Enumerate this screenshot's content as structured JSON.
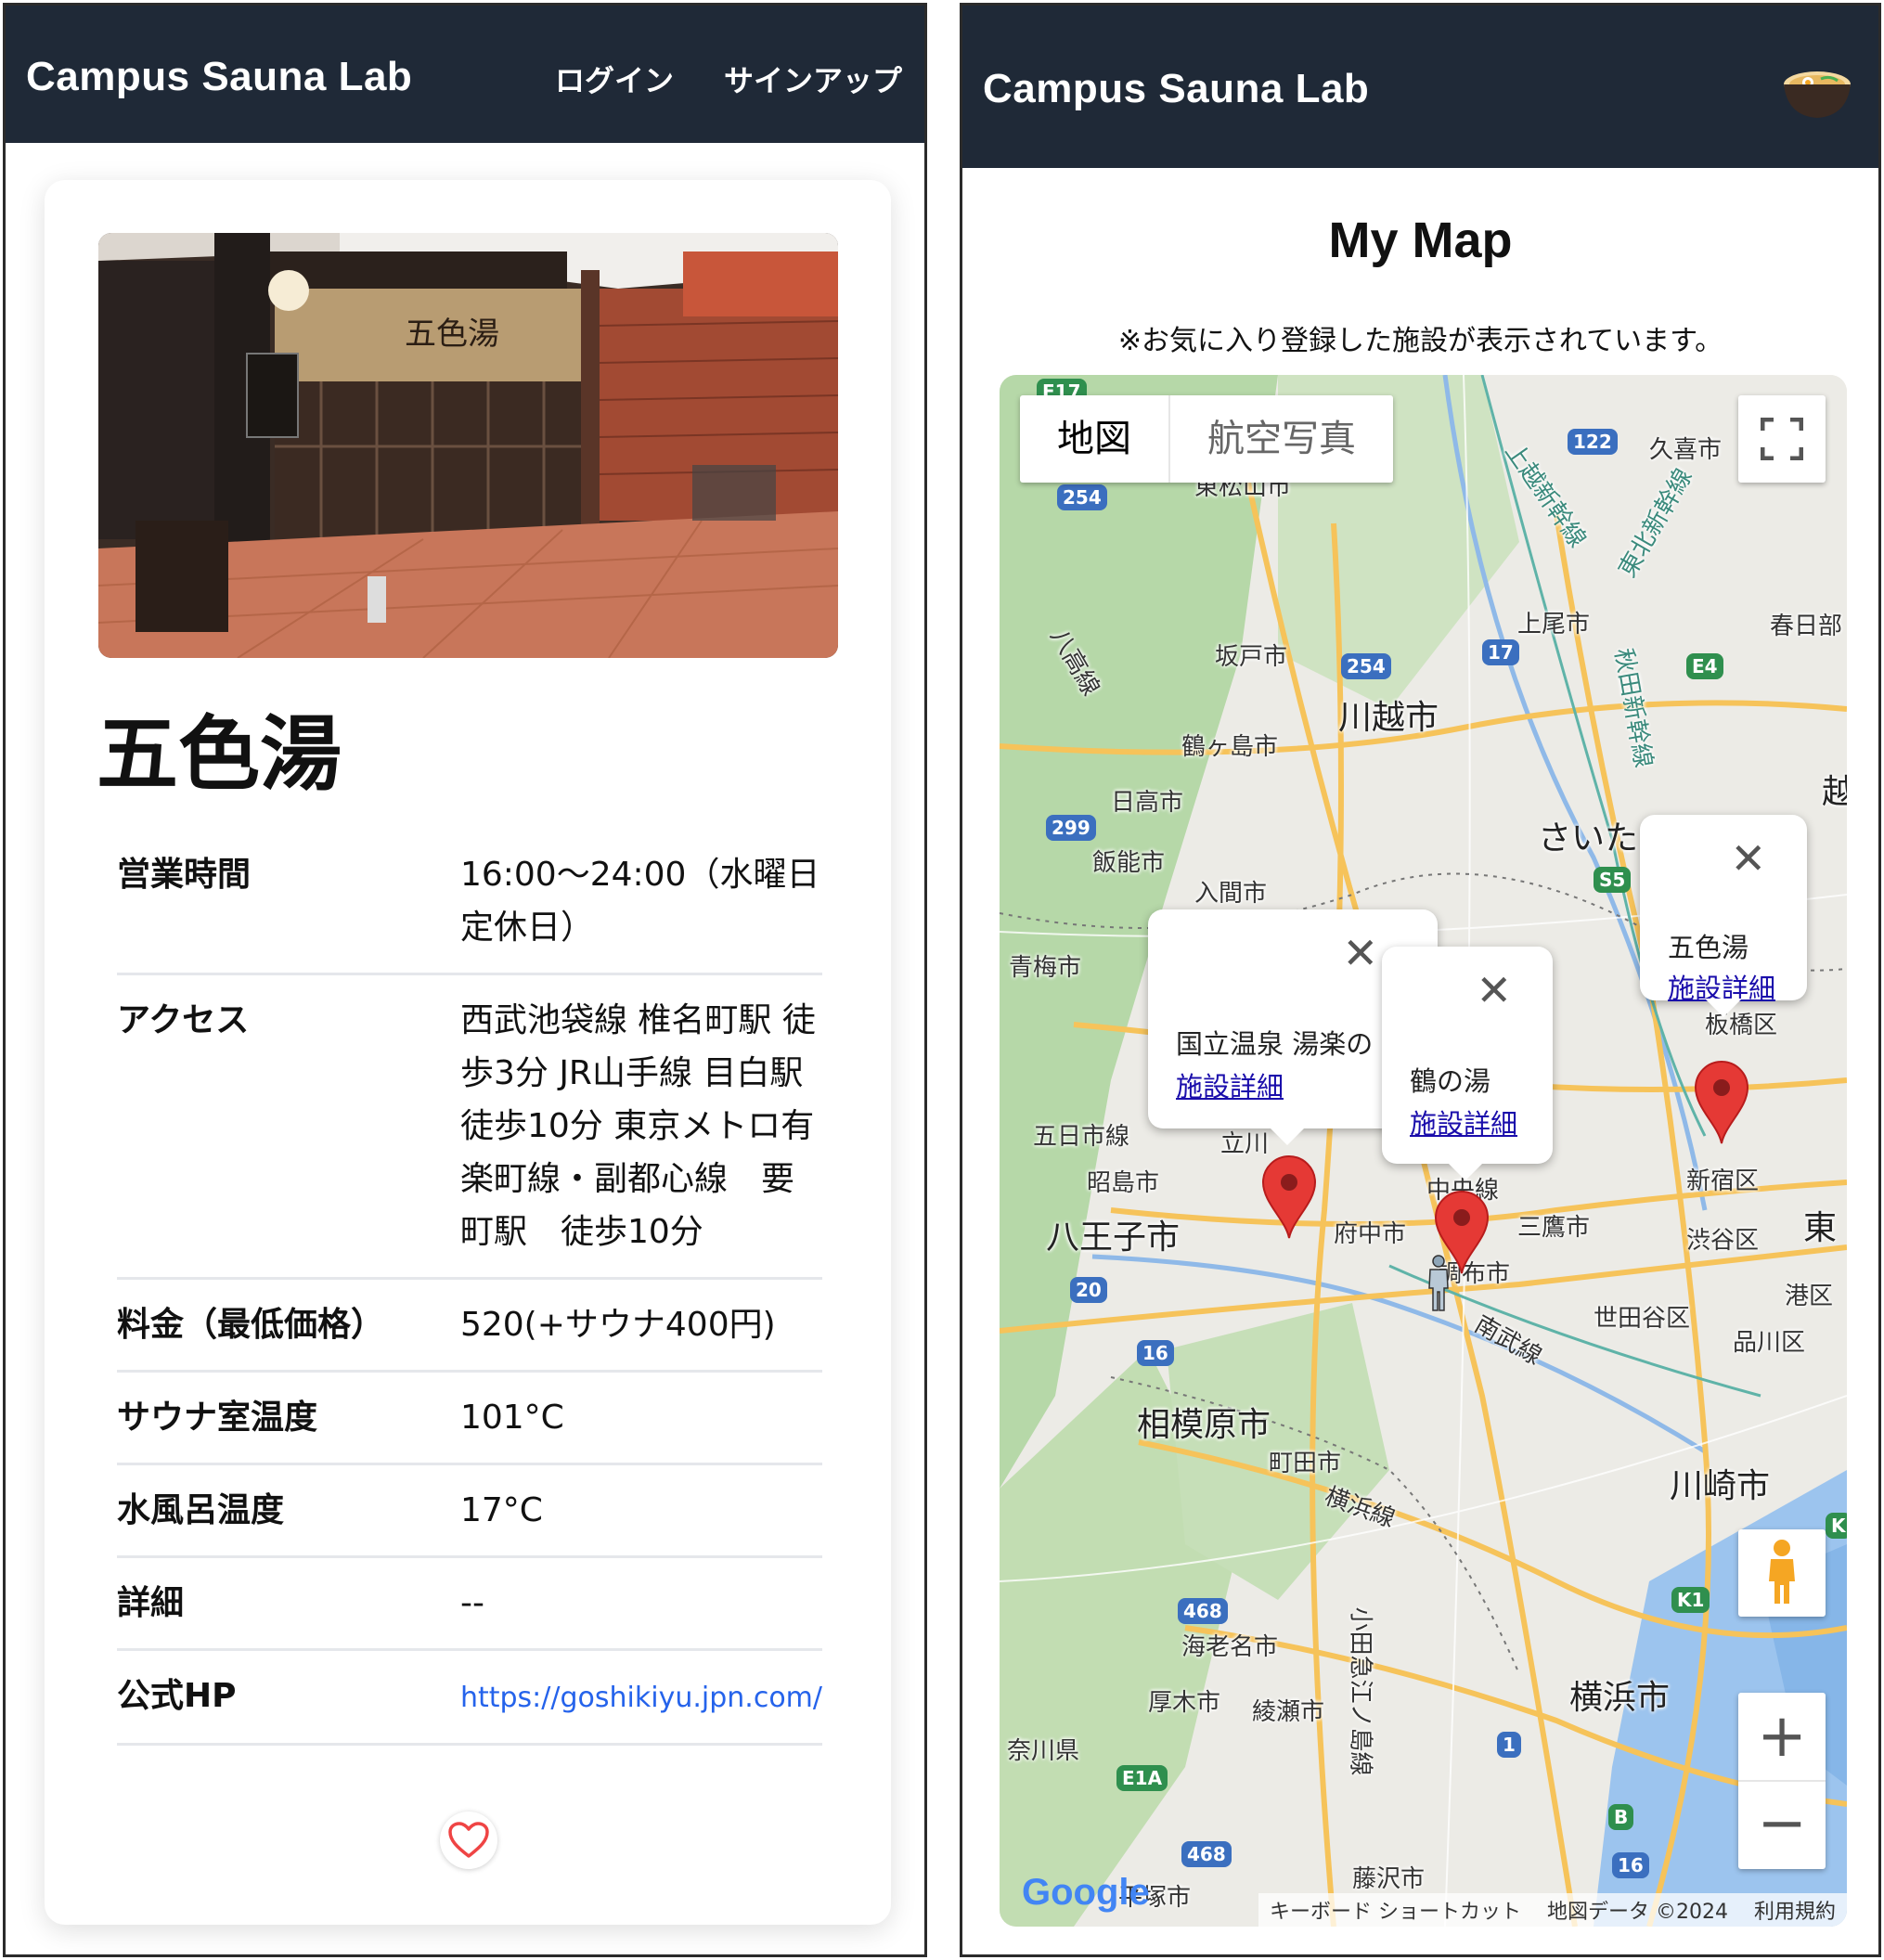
{
  "left": {
    "navbar": {
      "brand": "Campus Sauna Lab",
      "login": "ログイン",
      "signup": "サインアップ"
    },
    "facility": {
      "name": "五色湯",
      "photo_icon": "bathhouse-photo",
      "rows": [
        {
          "label": "営業時間",
          "value": "16:00〜24:00（水曜日 定休日）"
        },
        {
          "label": "アクセス",
          "value": "西武池袋線 椎名町駅 徒歩3分 JR山手線 目白駅 徒歩10分 東京メトロ有楽町線・副都心線　要町駅　徒歩10分"
        },
        {
          "label": "料金（最低価格）",
          "value": "520(+サウナ400円)"
        },
        {
          "label": "サウナ室温度",
          "value": "101°C"
        },
        {
          "label": "水風呂温度",
          "value": "17°C"
        },
        {
          "label": "詳細",
          "value": "--"
        },
        {
          "label": "公式HP",
          "value": "https://goshikiyu.jpn.com/"
        }
      ],
      "favorite_icon": "heart-icon"
    }
  },
  "right": {
    "navbar": {
      "brand": "Campus Sauna Lab",
      "avatar_icon": "ramen-bowl-icon"
    },
    "title": "My Map",
    "note": "※お気に入り登録した施設が表示されています。",
    "map": {
      "type_map": "地図",
      "type_satellite": "航空写真",
      "fullscreen_icon": "fullscreen-icon",
      "pegman_icon": "pegman-icon",
      "zoom_in": "+",
      "zoom_out": "−",
      "places": [
        "東松山市",
        "久喜市",
        "上越新幹線",
        "東北新幹線",
        "上尾市",
        "春日部",
        "坂戸市",
        "川越市",
        "鶴ヶ島市",
        "八高線",
        "日高市",
        "秋田新幹線",
        "飯能市",
        "さいた",
        "入間市",
        "青梅市",
        "板橋区",
        "五日市線",
        "立川",
        "昭島市",
        "中央線",
        "三鷹市",
        "八王子市",
        "府中市",
        "調布市",
        "新宿区",
        "渋谷区",
        "東",
        "港区",
        "世田谷区",
        "品川区",
        "南武線",
        "相模原市",
        "町田市",
        "横浜線",
        "川崎市",
        "海老名市",
        "小田急江ノ島線",
        "厚木市",
        "綾瀬市",
        "奈川県",
        "横浜市",
        "平塚市",
        "藤沢市",
        "越"
      ],
      "highways": [
        "E17",
        "254",
        "122",
        "254",
        "17",
        "E4",
        "299",
        "S5",
        "20",
        "16",
        "468",
        "K1",
        "E1A",
        "468",
        "1",
        "B",
        "16",
        "K"
      ],
      "markers": [
        {
          "name": "国立温泉 湯楽の",
          "link": "施設詳細"
        },
        {
          "name": "鶴の湯",
          "link": "施設詳細"
        },
        {
          "name": "五色湯",
          "link": "施設詳細"
        }
      ],
      "close_icon": "close-icon",
      "logo": "Google",
      "attribution": [
        "キーボード ショートカット",
        "地図データ ©2024",
        "利用規約"
      ]
    }
  }
}
